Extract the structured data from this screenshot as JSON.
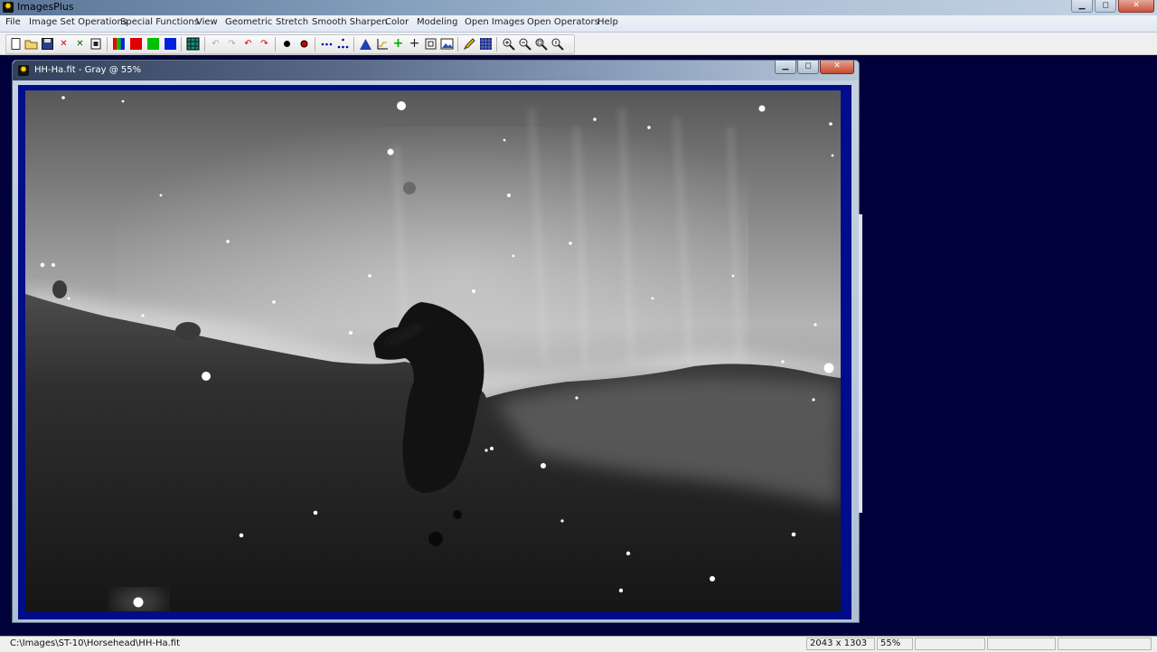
{
  "app": {
    "title": "ImagesPlus"
  },
  "menu": [
    "File",
    "Image Set Operations",
    "Special Functions",
    "View",
    "Geometric",
    "Stretch",
    "Smooth Sharpen",
    "Color",
    "Modeling",
    "Open Images",
    "Open Operators",
    "Help"
  ],
  "toolbar": {
    "icons": [
      "new-icon",
      "open-icon",
      "save-icon",
      "close-red-icon",
      "close-green-icon",
      "copy-icon",
      "rgb-icon",
      "red-channel-icon",
      "green-channel-icon",
      "blue-channel-icon",
      "grid-icon",
      "undo-icon",
      "redo-icon",
      "undo-red-icon",
      "redo-red-icon",
      "circle-black-icon",
      "circle-red-icon",
      "dots-line-icon",
      "dots-split-icon",
      "histogram-icon",
      "axis-icon",
      "green-cross-icon",
      "crosshair-icon",
      "box-icon",
      "image-icon",
      "pencil-icon",
      "matrix-icon",
      "zoom-in-icon",
      "zoom-out-icon",
      "zoom-fit-icon",
      "zoom-actual-icon"
    ],
    "colors": {
      "red": "#e00000",
      "green": "#00c000",
      "blue": "#0020e0"
    }
  },
  "child_window": {
    "title": "HH-Ha.fit - Gray @ 55%"
  },
  "status": {
    "path": "C:\\Images\\ST-10\\Horsehead\\HH-Ha.fit",
    "dimensions": "2043 x 1303",
    "zoom": "55%"
  }
}
